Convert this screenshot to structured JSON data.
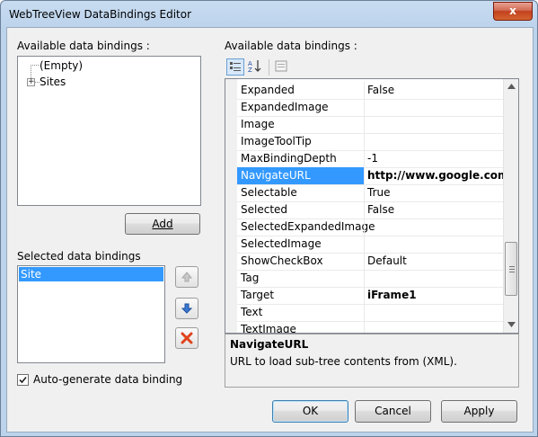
{
  "window": {
    "title": "WebTreeView DataBindings Editor",
    "close_glyph": "x"
  },
  "left": {
    "available_label": "Available data bindings :",
    "tree": [
      {
        "label": "(Empty)"
      },
      {
        "label": "Sites",
        "expander": "+"
      }
    ],
    "add_button": "Add",
    "selected_label": "Selected data bindings",
    "selected_items": [
      "Site"
    ],
    "autogen": {
      "label": "Auto-generate  data binding",
      "checked": true
    }
  },
  "right": {
    "available_label": "Available data bindings :",
    "toolbar": {
      "categorized_icon": "categorized-icon",
      "alphabetical_icon": "sort-az-icon",
      "property_pages_icon": "property-pages-icon"
    },
    "properties": [
      {
        "name": "Expanded",
        "value": "False",
        "bold": false
      },
      {
        "name": "ExpandedImage",
        "value": "",
        "bold": false
      },
      {
        "name": "Image",
        "value": "",
        "bold": false
      },
      {
        "name": "ImageToolTip",
        "value": "",
        "bold": false
      },
      {
        "name": "MaxBindingDepth",
        "value": "-1",
        "bold": false
      },
      {
        "name": "NavigateURL",
        "value": "http://www.google.com",
        "bold": true,
        "selected": true
      },
      {
        "name": "Selectable",
        "value": "True",
        "bold": false
      },
      {
        "name": "Selected",
        "value": "False",
        "bold": false
      },
      {
        "name": "SelectedExpandedImage",
        "value": "",
        "bold": false
      },
      {
        "name": "SelectedImage",
        "value": "",
        "bold": false
      },
      {
        "name": "ShowCheckBox",
        "value": "Default",
        "bold": false
      },
      {
        "name": "Tag",
        "value": "",
        "bold": false
      },
      {
        "name": "Target",
        "value": "iFrame1",
        "bold": true
      },
      {
        "name": "Text",
        "value": "",
        "bold": false
      },
      {
        "name": "TextImage",
        "value": "",
        "bold": false
      }
    ],
    "description": {
      "title": "NavigateURL",
      "text": "URL to load sub-tree contents from (XML)."
    }
  },
  "buttons": {
    "ok": "OK",
    "cancel": "Cancel",
    "apply": "Apply"
  },
  "colors": {
    "selection": "#3399ff",
    "title_gradient": "#bcd3ec",
    "close_red": "#c2401f"
  }
}
